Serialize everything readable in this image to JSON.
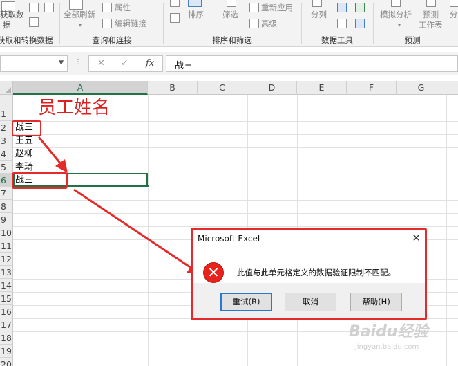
{
  "ribbon": {
    "get_data_partial": "获取数",
    "get_data_partial_2": "据",
    "get_transform_label": "获取和转换数据",
    "refresh_all": "全部刷新",
    "properties": "属性",
    "edit_links": "编辑链接",
    "queries_label": "查询和连接",
    "sort": "排序",
    "filter": "筛选",
    "reapply": "重新应用",
    "advanced": "高级",
    "sort_filter_label": "排序和筛选",
    "split": "分列",
    "data_tools_label": "数据工具",
    "what_if": "模拟分析",
    "forecast_sheet_1": "预测",
    "forecast_sheet_2": "工作表",
    "forecast_label": "预测",
    "outline_partial": "分"
  },
  "formula_bar": {
    "name_box": "",
    "cancel_glyph": "✕",
    "enter_glyph": "✓",
    "fx_glyph": "fx",
    "content": "战三"
  },
  "sheet": {
    "columns": [
      "A",
      "B",
      "C",
      "D",
      "E",
      "F",
      "G"
    ],
    "rows": [
      "1",
      "2",
      "3",
      "4",
      "5",
      "6",
      "7",
      "8",
      "9",
      "10",
      "11",
      "12",
      "13",
      "14",
      "15",
      "16",
      "17",
      "18",
      "19",
      "20"
    ],
    "title": "员工姓名",
    "cells": {
      "A2": "战三",
      "A3": "王五",
      "A4": "赵柳",
      "A5": "李琦",
      "A6": "战三"
    },
    "active_cell": "A6"
  },
  "dialog": {
    "title": "Microsoft Excel",
    "close_glyph": "✕",
    "icon_glyph": "✕",
    "message": "此值与此单元格定义的数据验证限制不匹配。",
    "retry": "重试(R)",
    "cancel": "取消",
    "help": "帮助(H)"
  },
  "annotations": {
    "color": "#e52a2a"
  },
  "watermark": {
    "text": "Baidu经验",
    "sub": "jingyan.baidu.com"
  }
}
